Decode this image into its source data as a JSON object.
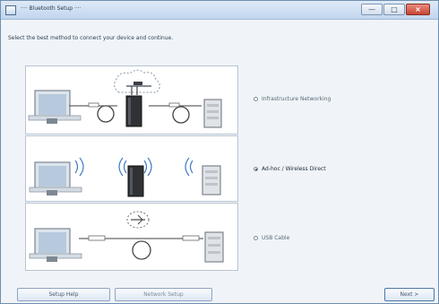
{
  "window": {
    "title": "···· Bluetooth Setup ····",
    "controls": {
      "minimize": "—",
      "maximize": "□",
      "close": "×"
    }
  },
  "instruction": "Select the best method to connect your device and continue.",
  "options": [
    {
      "label": "Infrastructure Networking",
      "selected": false
    },
    {
      "label": "Ad-hoc / Wireless Direct",
      "selected": true
    },
    {
      "label": "USB Cable",
      "selected": false
    }
  ],
  "buttons": {
    "left": "Setup Help",
    "middle": "Network Setup",
    "right": "Next >"
  },
  "colors": {
    "accent": "#2f5f95",
    "window_border": "#6f8fb0"
  },
  "icons": [
    "app-icon",
    "monitor-icon",
    "router-icon",
    "printer-icon",
    "cloud-icon",
    "usb-icon",
    "wifi-icon"
  ]
}
